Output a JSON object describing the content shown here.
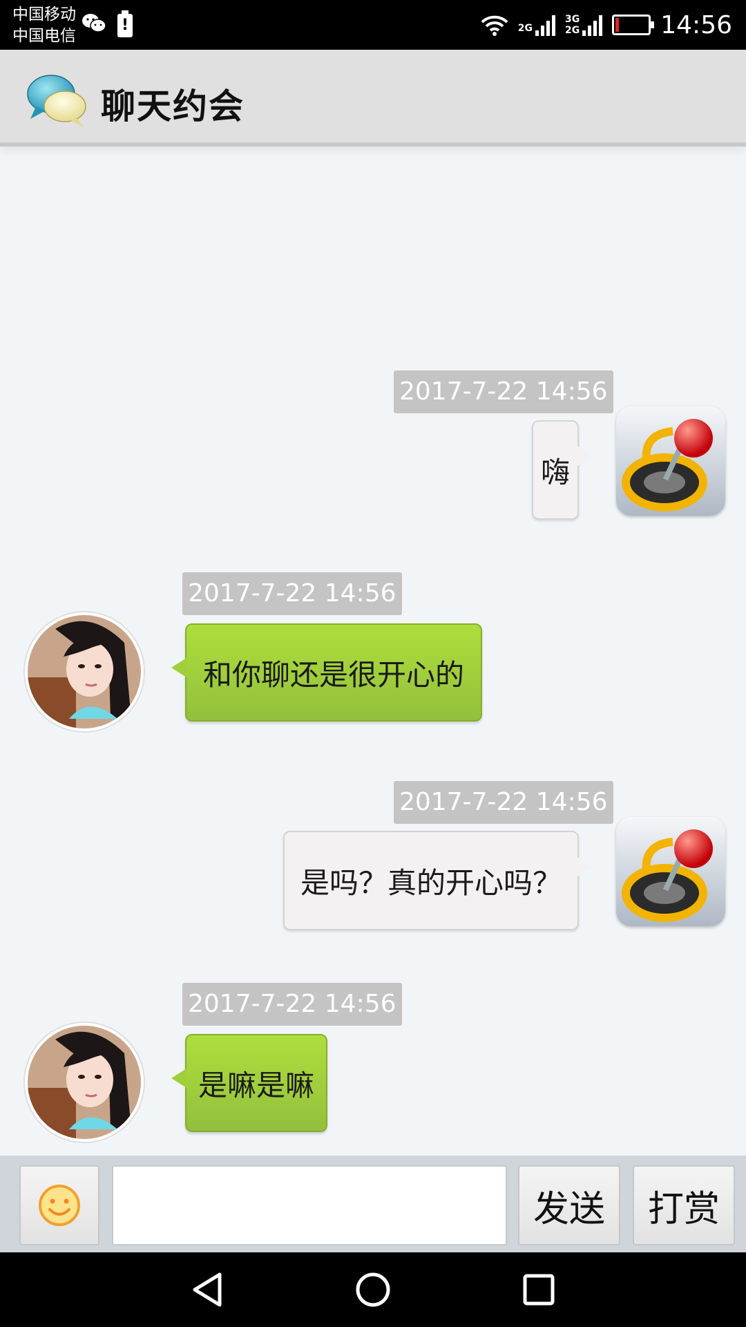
{
  "status_bar": {
    "carrier_1": "中国移动",
    "carrier_2": "中国电信",
    "network_1": "2G",
    "network_2_top": "3G",
    "network_2_bottom": "2G",
    "time": "14:56",
    "battery_level_fraction": 0.1,
    "battery_color": "#e0242a"
  },
  "header": {
    "title": "聊天约会",
    "logo_icon": "chat-bubbles-icon"
  },
  "messages": [
    {
      "direction": "sent",
      "timestamp": "2017-7-22 14:56",
      "text": "嗨"
    },
    {
      "direction": "received",
      "timestamp": "2017-7-22 14:56",
      "text": "和你聊还是很开心的"
    },
    {
      "direction": "sent",
      "timestamp": "2017-7-22 14:56",
      "text": "是吗？真的开心吗？"
    },
    {
      "direction": "received",
      "timestamp": "2017-7-22 14:56",
      "text": "是嘛是嘛"
    }
  ],
  "input_bar": {
    "emoji_icon": "smiley-icon",
    "input_value": "",
    "input_placeholder": "",
    "send_label": "发送",
    "tip_label": "打赏"
  },
  "nav_bar": {
    "back_icon": "back-triangle-icon",
    "home_icon": "home-circle-icon",
    "recents_icon": "recents-square-icon"
  },
  "colors": {
    "received_bubble": "#9fd03c",
    "sent_bubble": "#f3f1f1",
    "timestamp_bg": "#c4c4c4",
    "chat_bg": "#f2f5f7"
  }
}
